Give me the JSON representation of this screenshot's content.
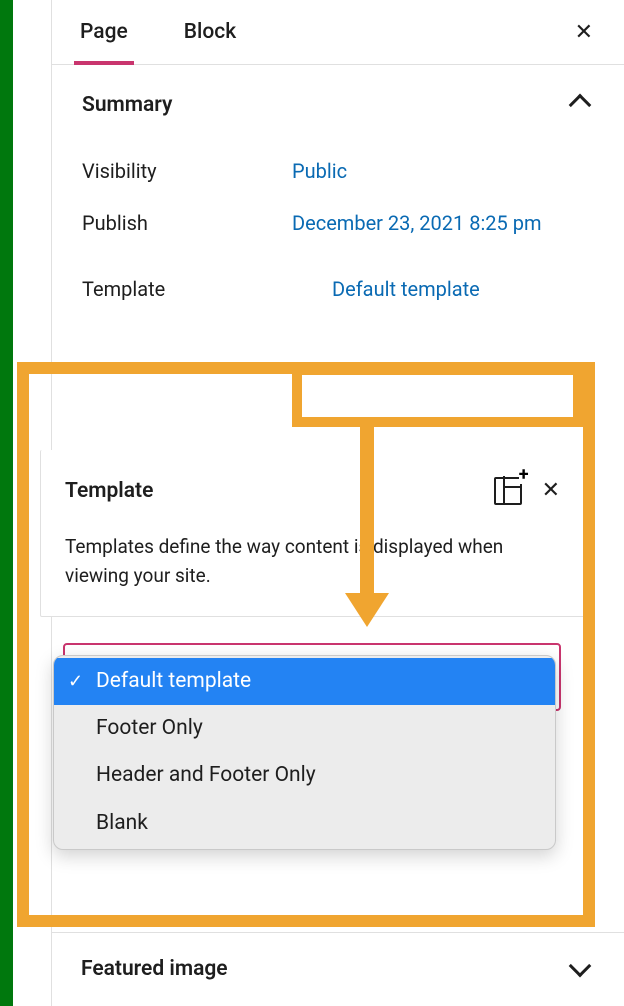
{
  "tabs": {
    "page": "Page",
    "block": "Block"
  },
  "summary": {
    "title": "Summary",
    "visibility_label": "Visibility",
    "visibility_value": "Public",
    "publish_label": "Publish",
    "publish_value": "December 23, 2021 8:25 pm",
    "template_label": "Template",
    "template_value": "Default template"
  },
  "popover": {
    "title": "Template",
    "description": "Templates define the way content is displayed when viewing your site."
  },
  "options": [
    {
      "label": "Default template",
      "selected": true
    },
    {
      "label": "Footer Only",
      "selected": false
    },
    {
      "label": "Header and Footer Only",
      "selected": false
    },
    {
      "label": "Blank",
      "selected": false
    }
  ],
  "featured": {
    "title": "Featured image"
  },
  "glyphs": {
    "check": "✓",
    "plus": "+",
    "close": "✕"
  }
}
